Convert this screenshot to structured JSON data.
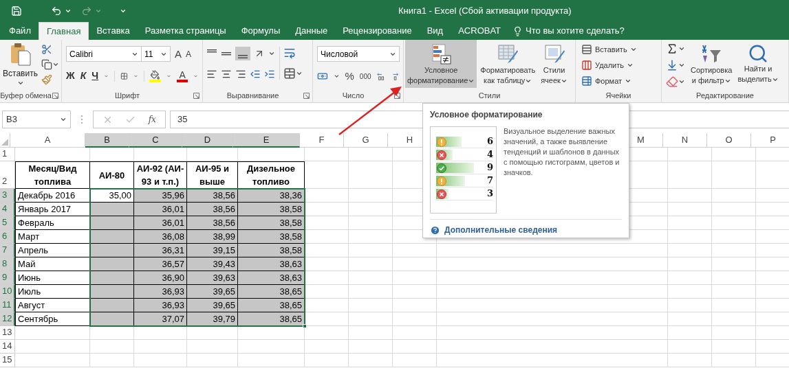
{
  "window": {
    "title": "Книга1 - Excel (Сбой активации продукта)"
  },
  "tabs": [
    {
      "label": "Файл",
      "selected": false
    },
    {
      "label": "Главная",
      "selected": true
    },
    {
      "label": "Вставка",
      "selected": false
    },
    {
      "label": "Разметка страницы",
      "selected": false
    },
    {
      "label": "Формулы",
      "selected": false
    },
    {
      "label": "Данные",
      "selected": false
    },
    {
      "label": "Рецензирование",
      "selected": false
    },
    {
      "label": "Вид",
      "selected": false
    },
    {
      "label": "ACROBAT",
      "selected": false
    }
  ],
  "tell_me": {
    "placeholder": "Что вы хотите сделать?"
  },
  "ribbon": {
    "groups": [
      {
        "kind": "clipboard",
        "label": "Буфер обмена",
        "paste": "Вставить"
      },
      {
        "kind": "font",
        "label": "Шрифт",
        "font_name": "Calibri",
        "font_size": "11",
        "grow": "A",
        "shrink": "A",
        "bold": "Ж",
        "italic": "К",
        "underline": "Ч",
        "font_color": "A"
      },
      {
        "kind": "alignment",
        "label": "Выравнивание"
      },
      {
        "kind": "number",
        "label": "Число",
        "format": "Числовой",
        "percent": "%",
        "thousands": "000"
      },
      {
        "kind": "styles",
        "label": "Стили",
        "buttons": [
          {
            "lines": [
              "Условное",
              "форматирование"
            ],
            "selected": true
          },
          {
            "lines": [
              "Форматировать",
              "как таблицу"
            ],
            "selected": false
          },
          {
            "lines": [
              "Стили",
              "ячеек"
            ],
            "selected": false
          }
        ]
      },
      {
        "kind": "cells",
        "label": "Ячейки",
        "buttons": [
          "Вставить",
          "Удалить",
          "Формат"
        ]
      },
      {
        "kind": "editing",
        "label": "Редактирование",
        "buttons": [
          [
            "Сортировка",
            "и фильтр"
          ],
          [
            "Найти и",
            "выделить"
          ]
        ]
      }
    ]
  },
  "formula_bar": {
    "name_box": "B3",
    "function_label": "fx",
    "value": "35"
  },
  "sheet": {
    "columns": [
      {
        "label": "A",
        "selected": false
      },
      {
        "label": "B",
        "selected": true
      },
      {
        "label": "C",
        "selected": true
      },
      {
        "label": "D",
        "selected": true
      },
      {
        "label": "E",
        "selected": true
      },
      {
        "label": "F",
        "selected": false
      },
      {
        "label": "G",
        "selected": false
      },
      {
        "label": "H",
        "selected": false
      },
      {
        "label": "M",
        "selected": false
      },
      {
        "label": "N",
        "selected": false
      },
      {
        "label": "O",
        "selected": false
      },
      {
        "label": "P",
        "selected": false
      }
    ],
    "rows": [
      {
        "number": "1",
        "kind": "empty",
        "selected": false
      },
      {
        "number": "2",
        "kind": "header",
        "selected": false,
        "cells": [
          [
            "Месяц/Вид",
            "топлива"
          ],
          [
            "АИ-80"
          ],
          [
            "АИ-92 (АИ-",
            "93 и т.п.)"
          ],
          [
            "АИ-95 и",
            "выше"
          ],
          [
            "Дизельное",
            "топливо"
          ]
        ]
      },
      {
        "number": "3",
        "kind": "data",
        "selected": true,
        "active": true,
        "cells": [
          "Декабрь 2016",
          "35,00",
          "35,96",
          "38,56",
          "38,36"
        ]
      },
      {
        "number": "4",
        "kind": "data",
        "selected": true,
        "active": false,
        "cells": [
          "Январь 2017",
          "",
          "36,01",
          "38,56",
          "38,58"
        ]
      },
      {
        "number": "5",
        "kind": "data",
        "selected": true,
        "active": false,
        "cells": [
          "Февраль",
          "",
          "36,01",
          "38,56",
          "38,58"
        ]
      },
      {
        "number": "6",
        "kind": "data",
        "selected": true,
        "active": false,
        "cells": [
          "Март",
          "",
          "36,08",
          "38,99",
          "38,58"
        ]
      },
      {
        "number": "7",
        "kind": "data",
        "selected": true,
        "active": false,
        "cells": [
          "Апрель",
          "",
          "36,31",
          "39,15",
          "38,58"
        ]
      },
      {
        "number": "8",
        "kind": "data",
        "selected": true,
        "active": false,
        "cells": [
          "Май",
          "",
          "36,57",
          "39,43",
          "38,63"
        ]
      },
      {
        "number": "9",
        "kind": "data",
        "selected": true,
        "active": false,
        "cells": [
          "Июнь",
          "",
          "36,90",
          "39,63",
          "38,63"
        ]
      },
      {
        "number": "10",
        "kind": "data",
        "selected": true,
        "active": false,
        "cells": [
          "Июль",
          "",
          "36,93",
          "39,65",
          "38,65"
        ]
      },
      {
        "number": "11",
        "kind": "data",
        "selected": true,
        "active": false,
        "cells": [
          "Август",
          "",
          "36,93",
          "39,65",
          "38,65"
        ]
      },
      {
        "number": "12",
        "kind": "data",
        "selected": true,
        "active": false,
        "cells": [
          "Сентябрь",
          "",
          "37,07",
          "39,79",
          "38,65"
        ]
      },
      {
        "number": "13",
        "kind": "empty",
        "selected": false
      },
      {
        "number": "14",
        "kind": "empty",
        "selected": false
      },
      {
        "number": "15",
        "kind": "empty",
        "selected": false
      }
    ]
  },
  "tooltip": {
    "title": "Условное форматирование",
    "description": "Визуальное выделение важных значений, а также выявление тенденций и шаблонов в данных с помощью гистограмм, цветов и значков.",
    "link": "Дополнительные сведения",
    "sample": [
      {
        "kind": "warning",
        "level": 0.62,
        "value": "6"
      },
      {
        "kind": "error",
        "level": 0.4,
        "value": "4"
      },
      {
        "kind": "ok",
        "level": 0.92,
        "value": "9"
      },
      {
        "kind": "warning",
        "level": 0.7,
        "value": "7"
      },
      {
        "kind": "error",
        "level": 0.3,
        "value": "3"
      }
    ]
  }
}
